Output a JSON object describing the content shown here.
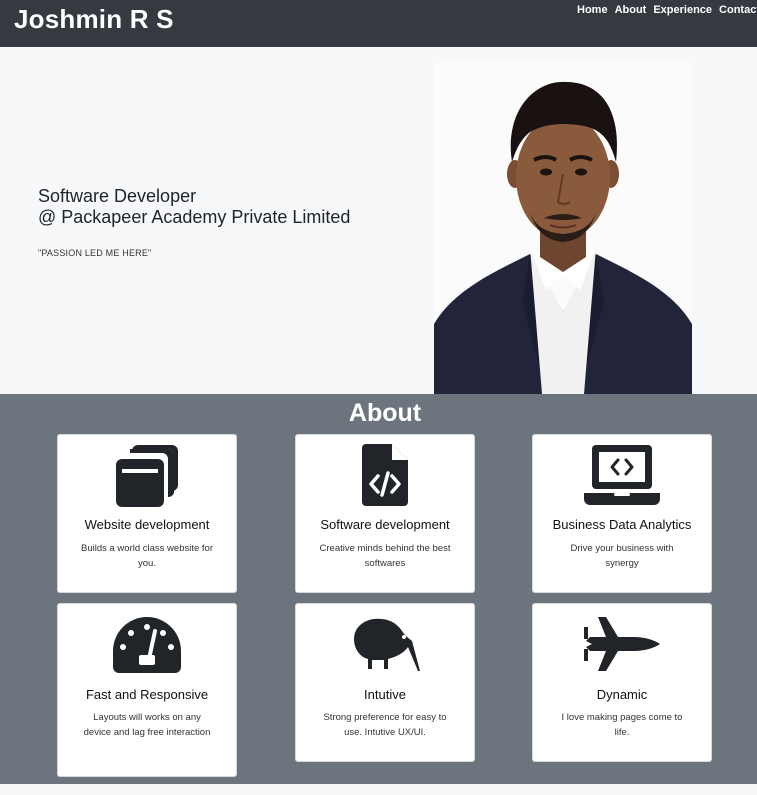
{
  "navbar": {
    "brand": "Joshmin R S",
    "links": [
      "Home",
      "About",
      "Experience",
      "Contact Me"
    ]
  },
  "hero": {
    "title_line1": "Software Developer",
    "title_line2": "@ Packapeer Academy Private Limited",
    "tagline": "\"PASSION LED ME HERE\""
  },
  "about": {
    "title": "About",
    "cards": [
      {
        "icon": "window-stack-icon",
        "title": "Website development",
        "text": "Builds a world class website for you."
      },
      {
        "icon": "code-file-icon",
        "title": "Software development",
        "text": "Creative minds behind the best softwares"
      },
      {
        "icon": "laptop-code-icon",
        "title": "Business Data Analytics",
        "text": "Drive your business with synergy"
      },
      {
        "icon": "speedometer-icon",
        "title": "Fast and Responsive",
        "text": "Layouts will works on any device and lag free interaction"
      },
      {
        "icon": "kiwi-bird-icon",
        "title": "Intutive",
        "text": "Strong preference for easy to use. Intutive UX/UI."
      },
      {
        "icon": "fighter-jet-icon",
        "title": "Dynamic",
        "text": "I love making pages come to life."
      }
    ]
  }
}
